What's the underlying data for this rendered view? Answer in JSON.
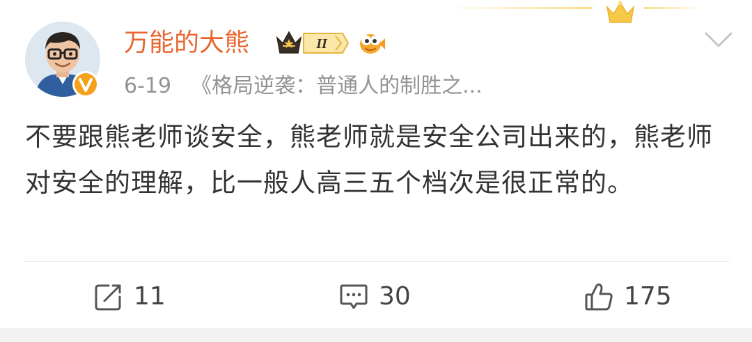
{
  "post": {
    "author": {
      "name": "万能的大熊",
      "level_badge": "II"
    },
    "date": "6-19",
    "source": "《格局逆袭：普通人的制胜之...",
    "text": "不要跟熊老师谈安全，熊老师就是安全公司出来的，熊老师对安全的理解，比一般人高三五个档次是很正常的。"
  },
  "actions": {
    "repost_count": "11",
    "comment_count": "30",
    "like_count": "175"
  },
  "colors": {
    "username": "#e8662f",
    "meta": "#939393",
    "body_text": "#333333",
    "verified_badge": "#f4a21b",
    "crown": "#f5c542"
  },
  "icons": [
    "crown-icon",
    "verified-v-icon",
    "level-crown-badge-icon",
    "fish-badge-icon",
    "chevron-down-icon",
    "repost-icon",
    "comment-icon",
    "like-icon"
  ]
}
